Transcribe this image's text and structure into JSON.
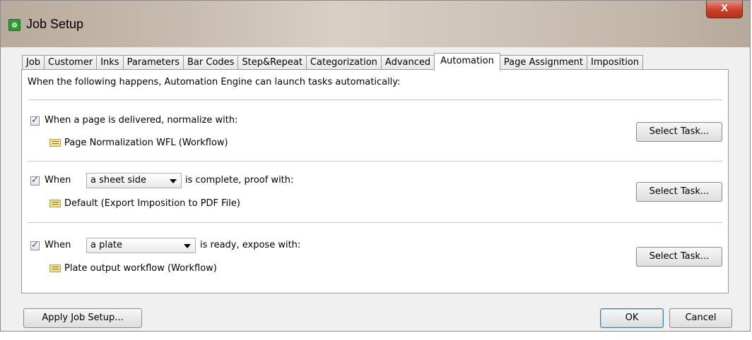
{
  "window": {
    "title": "Job Setup",
    "close_label": "X"
  },
  "tabs": [
    {
      "label": "Job"
    },
    {
      "label": "Customer"
    },
    {
      "label": "Inks"
    },
    {
      "label": "Parameters"
    },
    {
      "label": "Bar Codes"
    },
    {
      "label": "Step&Repeat"
    },
    {
      "label": "Categorization"
    },
    {
      "label": "Advanced"
    },
    {
      "label": "Automation",
      "active": true
    },
    {
      "label": "Page Assignment"
    },
    {
      "label": "Imposition"
    }
  ],
  "automation": {
    "intro": "When the following happens, Automation Engine can launch tasks automatically:",
    "rule1": {
      "checked": true,
      "label": "When a page is delivered, normalize with:",
      "task": "Page Normalization WFL (Workflow)",
      "button": "Select Task..."
    },
    "rule2": {
      "checked": true,
      "prefix": "When",
      "select_value": "a sheet side",
      "suffix": "is complete, proof with:",
      "task": "Default (Export Imposition to PDF File)",
      "button": "Select Task..."
    },
    "rule3": {
      "checked": true,
      "prefix": "When",
      "select_value": "a plate",
      "suffix": "is ready, expose with:",
      "task": "Plate output workflow (Workflow)",
      "button": "Select Task..."
    }
  },
  "footer": {
    "apply_label": "Apply Job Setup...",
    "ok_label": "OK",
    "cancel_label": "Cancel"
  }
}
